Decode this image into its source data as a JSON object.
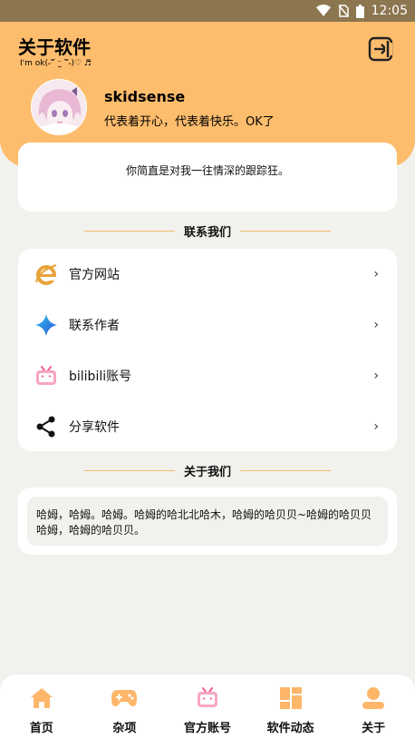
{
  "status_bar": {
    "time": "12:05",
    "icons": [
      "wifi-icon",
      "no-sim-icon",
      "battery-icon"
    ]
  },
  "header": {
    "title": "关于软件",
    "subtitle": "I'm ok(˶‾᷄ ⁻̫ ‾᷅˵)♡ ♬",
    "exit_icon": "exit-icon",
    "username": "skidsense",
    "motto": "代表着开心，代表着快乐。OK了"
  },
  "quote": "你简直是对我一往情深的跟踪狂。",
  "contact_section": {
    "title": "联系我们"
  },
  "contact_items": [
    {
      "label": "官方网站",
      "icon": "ie-browser-icon",
      "chevron": "›"
    },
    {
      "label": "联系作者",
      "icon": "sparkle-star-icon",
      "chevron": "›"
    },
    {
      "label": "bilibili账号",
      "icon": "bilibili-tv-icon",
      "chevron": "›"
    },
    {
      "label": "分享软件",
      "icon": "share-icon",
      "chevron": "›"
    }
  ],
  "about_section": {
    "title": "关于我们",
    "text": "哈姆，哈姆。哈姆。哈姆的哈北北哈木，哈姆的哈贝贝~哈姆的哈贝贝哈姆，哈姆的哈贝贝。"
  },
  "bottom_nav": [
    {
      "label": "首页",
      "icon": "home-icon"
    },
    {
      "label": "杂项",
      "icon": "gamepad-icon"
    },
    {
      "label": "官方账号",
      "icon": "bilibili-tv-icon"
    },
    {
      "label": "软件动态",
      "icon": "dashboard-icon"
    },
    {
      "label": "关于",
      "icon": "user-icon"
    }
  ],
  "colors": {
    "accent": "#fdbd6d",
    "status_bar": "#8b7650",
    "background": "#f1f2ee",
    "divider": "#f3b868"
  }
}
